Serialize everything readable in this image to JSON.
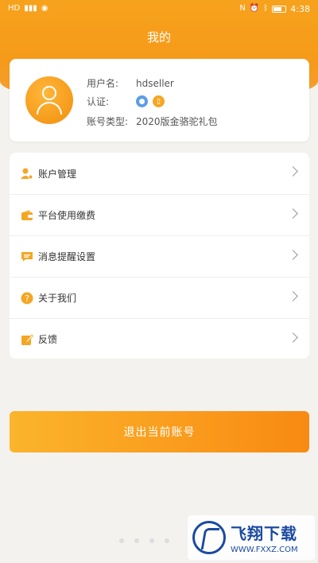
{
  "status_bar": {
    "left_text": "HD",
    "time": "4:38"
  },
  "header": {
    "title": "我的"
  },
  "profile": {
    "username_label": "用户名:",
    "username_value": "hdseller",
    "auth_label": "认证:",
    "account_type_label": "账号类型:",
    "account_type_value": "2020版金骆驼礼包"
  },
  "menu": {
    "items": [
      {
        "label": "账户管理",
        "icon": "user-gear-icon",
        "color": "#f5a623"
      },
      {
        "label": "平台使用缴费",
        "icon": "wallet-icon",
        "color": "#f5a623"
      },
      {
        "label": "消息提醒设置",
        "icon": "message-icon",
        "color": "#f5a623"
      },
      {
        "label": "关于我们",
        "icon": "question-icon",
        "color": "#f5a623"
      },
      {
        "label": "反馈",
        "icon": "edit-icon",
        "color": "#f5a623"
      }
    ]
  },
  "logout_label": "退出当前账号",
  "watermark": {
    "name": "飞翔下载",
    "url": "WWW.FXXZ.COM"
  },
  "colors": {
    "accent": "#f59a1a",
    "button_start": "#fbb42c",
    "button_end": "#f98a12"
  }
}
